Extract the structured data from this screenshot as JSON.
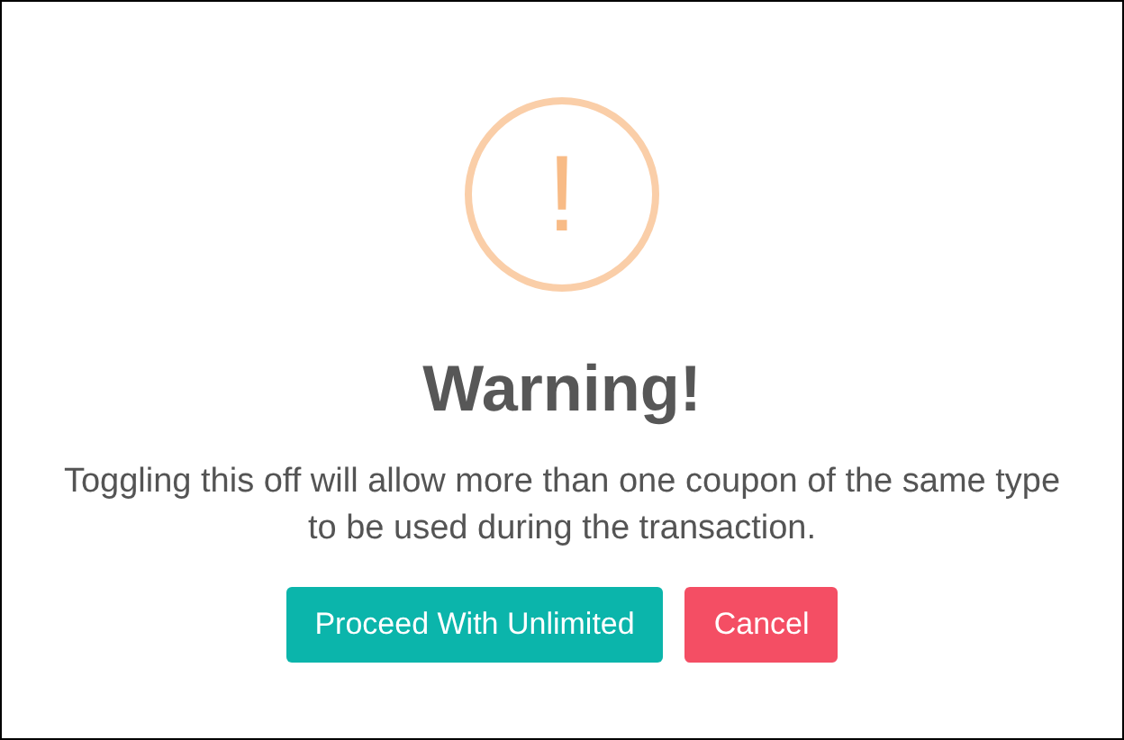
{
  "dialog": {
    "icon_glyph": "!",
    "title": "Warning!",
    "message": "Toggling this off will allow more than one coupon of the same type to be used during the transaction.",
    "buttons": [
      {
        "label": "Proceed With Unlimited",
        "kind": "confirm"
      },
      {
        "label": "Cancel",
        "kind": "cancel"
      }
    ]
  }
}
